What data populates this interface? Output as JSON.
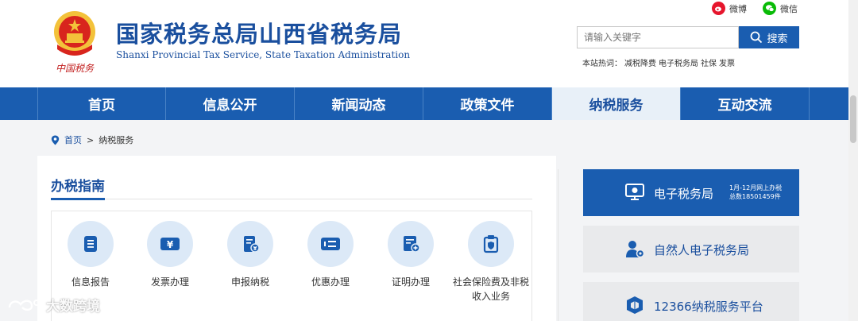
{
  "header": {
    "title": "国家税务总局山西省税务局",
    "subtitle": "Shanxi Provincial Tax Service, State Taxation Administration",
    "emblem_text": "中国税务",
    "social": [
      {
        "label": "微博",
        "icon": "weibo-icon",
        "color": "#e6162d"
      },
      {
        "label": "微信",
        "icon": "wechat-icon",
        "color": "#09bb07"
      }
    ],
    "search": {
      "placeholder": "请输入关键字",
      "button_label": "搜索"
    },
    "hot": {
      "label": "本站热词：",
      "terms": [
        "减税降费",
        "电子税务局",
        "社保",
        "发票"
      ]
    }
  },
  "nav": {
    "items": [
      {
        "label": "首页",
        "active": false
      },
      {
        "label": "信息公开",
        "active": false
      },
      {
        "label": "新闻动态",
        "active": false
      },
      {
        "label": "政策文件",
        "active": false
      },
      {
        "label": "纳税服务",
        "active": true
      },
      {
        "label": "互动交流",
        "active": false
      }
    ]
  },
  "breadcrumb": {
    "home": "首页",
    "separator": ">",
    "current": "纳税服务"
  },
  "guide": {
    "title": "办税指南",
    "services": [
      {
        "label": "信息报告",
        "icon": "document-icon"
      },
      {
        "label": "发票办理",
        "icon": "invoice-yen-icon"
      },
      {
        "label": "申报纳税",
        "icon": "tax-declaration-icon"
      },
      {
        "label": "优惠办理",
        "icon": "discount-card-icon"
      },
      {
        "label": "证明办理",
        "icon": "certificate-icon"
      },
      {
        "label": "社会保险费及非税收入业务",
        "icon": "social-insurance-icon"
      }
    ]
  },
  "sidebar": {
    "buttons": [
      {
        "label": "电子税务局",
        "icon": "monitor-icon",
        "note_line1": "1月-12月网上办税",
        "note_line2": "总数18501459件"
      },
      {
        "label": "自然人电子税务局",
        "icon": "person-icon"
      },
      {
        "label": "12366纳税服务平台",
        "icon": "cube-icon"
      }
    ]
  },
  "watermark": {
    "text": "大数跨境"
  },
  "colors": {
    "primary": "#1a5db0",
    "title": "#1a4f9e",
    "icon_bg": "#dce9f7",
    "content_bg": "#f3f4f6"
  }
}
